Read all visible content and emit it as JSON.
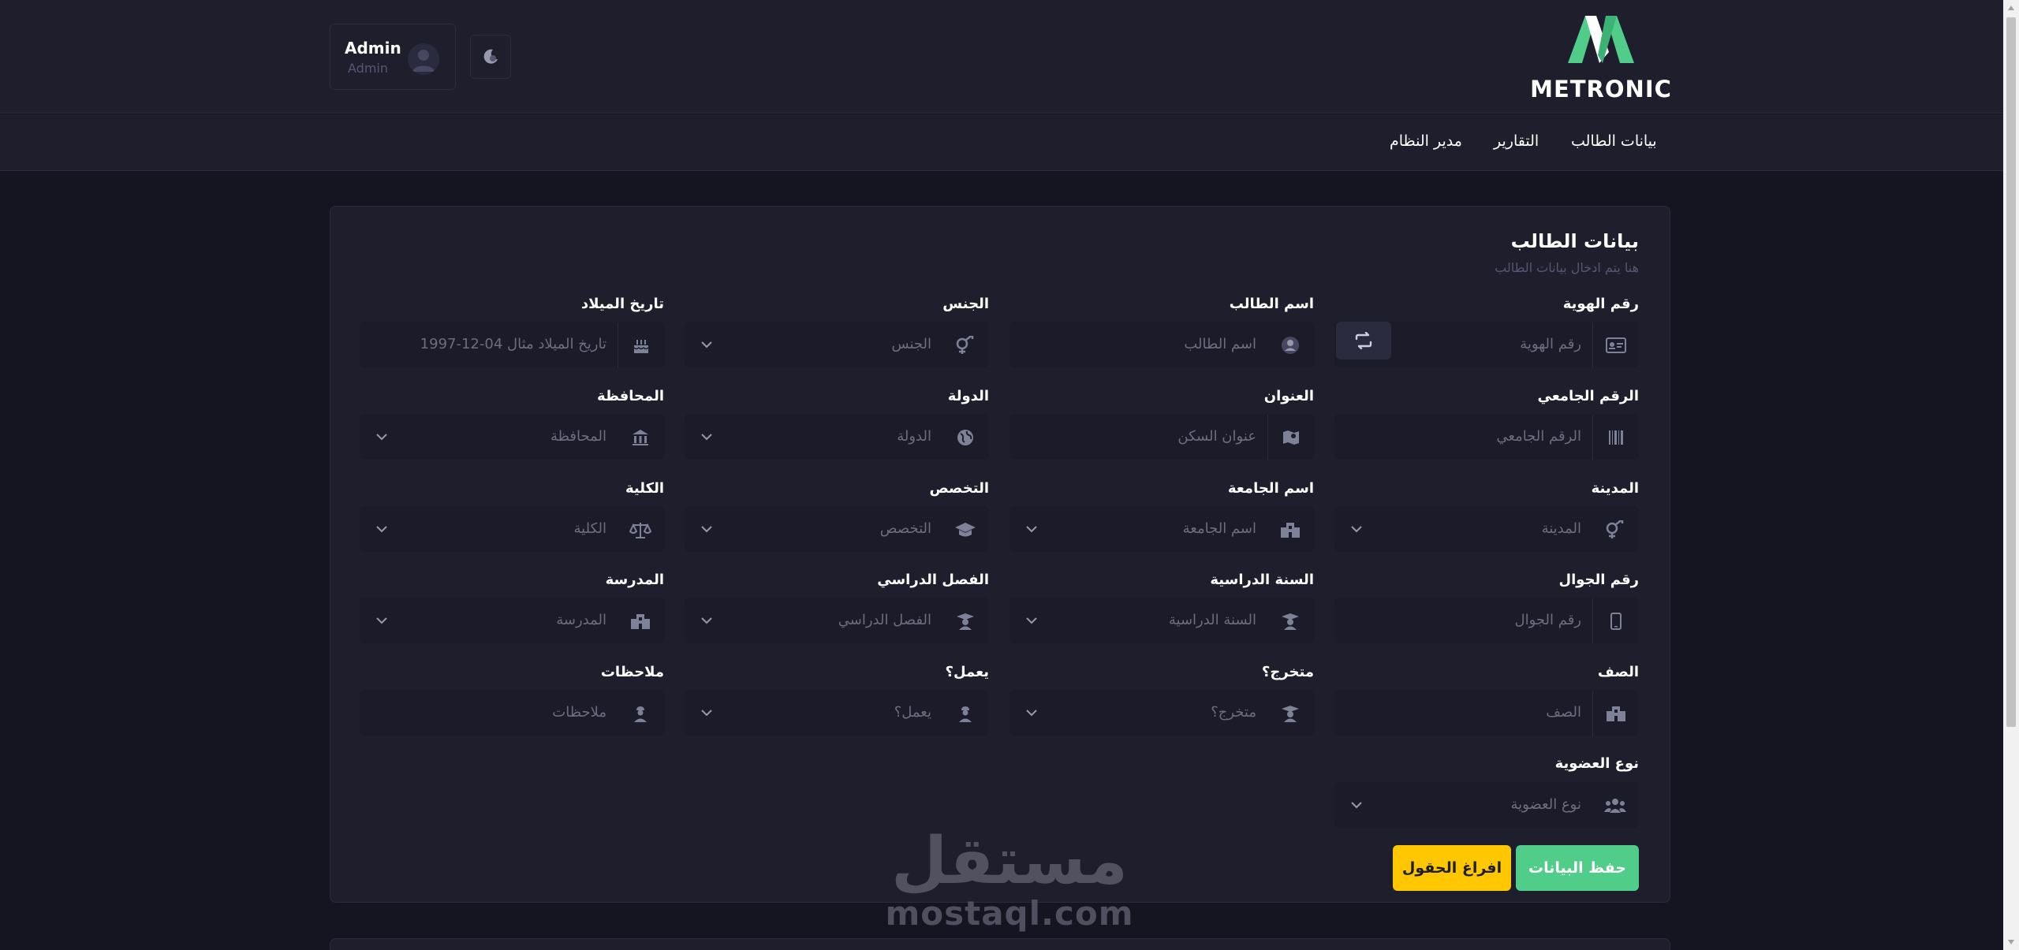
{
  "brand": {
    "name": "METRONIC"
  },
  "user": {
    "name": "Admin",
    "role": "Admin"
  },
  "nav": [
    {
      "label": "بيانات الطالب"
    },
    {
      "label": "التقارير"
    },
    {
      "label": "مدير النظام"
    }
  ],
  "card": {
    "title": "بيانات الطالب",
    "subtitle": "هنا يتم ادخال بيانات الطالب"
  },
  "fields": [
    {
      "label": "رقم الهوية",
      "placeholder": "رقم الهوية",
      "icon": "id-card-icon"
    },
    {
      "label": "اسم الطالب",
      "placeholder": "اسم الطالب",
      "icon": "user-icon"
    },
    {
      "label": "الجنس",
      "placeholder": "الجنس",
      "icon": "gender-icon"
    },
    {
      "label": "تاريخ الميلاد",
      "placeholder": "تاريخ الميلاد مثال 04-12-1997",
      "icon": "cake-icon"
    },
    {
      "label": "الرقم الجامعي",
      "placeholder": "الرقم الجامعي",
      "icon": "barcode-icon"
    },
    {
      "label": "العنوان",
      "placeholder": "عنوان السكن",
      "icon": "map-icon"
    },
    {
      "label": "الدولة",
      "placeholder": "الدولة",
      "icon": "globe-icon"
    },
    {
      "label": "المحافظة",
      "placeholder": "المحافظة",
      "icon": "bank-icon"
    },
    {
      "label": "المدينة",
      "placeholder": "المدينة",
      "icon": "gender-icon"
    },
    {
      "label": "اسم الجامعة",
      "placeholder": "اسم الجامعة",
      "icon": "building-icon"
    },
    {
      "label": "التخصص",
      "placeholder": "التخصص",
      "icon": "graduation-cap-icon"
    },
    {
      "label": "الكلية",
      "placeholder": "الكلية",
      "icon": "scale-icon"
    },
    {
      "label": "رقم الجوال",
      "placeholder": "رقم الجوال",
      "icon": "mobile-icon"
    },
    {
      "label": "السنة الدراسية",
      "placeholder": "السنة الدراسية",
      "icon": "teacher-icon"
    },
    {
      "label": "الفصل الدراسي",
      "placeholder": "الفصل الدراسي",
      "icon": "teacher-icon"
    },
    {
      "label": "المدرسة",
      "placeholder": "المدرسة",
      "icon": "building-icon"
    },
    {
      "label": "الصف",
      "placeholder": "الصف",
      "icon": "building-icon"
    },
    {
      "label": "متخرج؟",
      "placeholder": "متخرج؟",
      "icon": "teacher-icon"
    },
    {
      "label": "يعمل؟",
      "placeholder": "يعمل؟",
      "icon": "worker-icon"
    },
    {
      "label": "ملاحظات",
      "placeholder": "ملاحظات",
      "icon": "worker-icon"
    },
    {
      "label": "نوع العضوية",
      "placeholder": "نوع العضوية",
      "icon": "users-icon"
    }
  ],
  "buttons": {
    "save": "حفظ البيانات",
    "clear": "افراغ الحقول"
  },
  "watermark": {
    "arabic": "مستقل",
    "latin": "mostaql.com"
  },
  "colors": {
    "background": "#151521",
    "panel": "#1e1e2d",
    "field": "#1b1b29",
    "success": "#50cd89",
    "warning": "#ffc700",
    "brand": "#50cd89"
  }
}
